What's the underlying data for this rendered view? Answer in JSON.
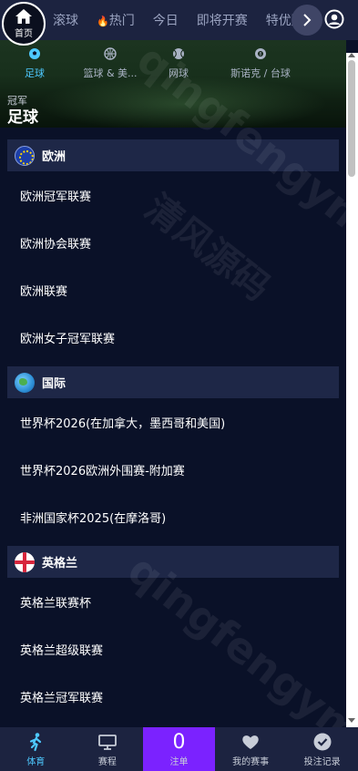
{
  "nav": {
    "home_label": "首页",
    "tabs": [
      {
        "label": "滚球"
      },
      {
        "label": "热门",
        "icon": "flame-icon"
      },
      {
        "label": "今日"
      },
      {
        "label": "即将开赛"
      },
      {
        "label": "特优赔"
      }
    ]
  },
  "sports": [
    {
      "label": "足球",
      "icon": "soccer-ball-icon",
      "active": true
    },
    {
      "label": "篮球 & 美...",
      "icon": "basketball-icon",
      "active": false
    },
    {
      "label": "网球",
      "icon": "tennis-ball-icon",
      "active": false
    },
    {
      "label": "斯诺克 / 台球",
      "icon": "billiard-ball-icon",
      "active": false
    }
  ],
  "hero": {
    "subtitle": "冠军",
    "title": "足球"
  },
  "sections": [
    {
      "title": "欧洲",
      "flag": "eu-flag",
      "leagues": [
        "欧洲冠军联赛",
        "欧洲协会联赛",
        "欧洲联赛",
        "欧洲女子冠军联赛"
      ]
    },
    {
      "title": "国际",
      "flag": "world-flag",
      "leagues": [
        "世界杯2026(在加拿大，墨西哥和美国)",
        "世界杯2026欧洲外围赛-附加赛",
        "非洲国家杯2025(在摩洛哥)"
      ]
    },
    {
      "title": "英格兰",
      "flag": "england-flag",
      "leagues": [
        "英格兰联赛杯",
        "英格兰超级联赛",
        "英格兰冠军联赛"
      ]
    }
  ],
  "watermark": {
    "domain": "qingfengymw",
    "chinese": "清风源码"
  },
  "bottom_nav": [
    {
      "label": "体育",
      "icon": "running-person-icon",
      "active": true
    },
    {
      "label": "赛程",
      "icon": "monitor-icon",
      "active": false
    },
    {
      "label": "注单",
      "count": "0",
      "active": false
    },
    {
      "label": "我的赛事",
      "icon": "heart-icon",
      "active": false
    },
    {
      "label": "投注记录",
      "icon": "check-circle-icon",
      "active": false
    }
  ],
  "colors": {
    "accent": "#4ec9ff",
    "bet_bg": "#7b22ff",
    "nav_bg": "#1c2340",
    "page_bg": "#0a1128"
  }
}
